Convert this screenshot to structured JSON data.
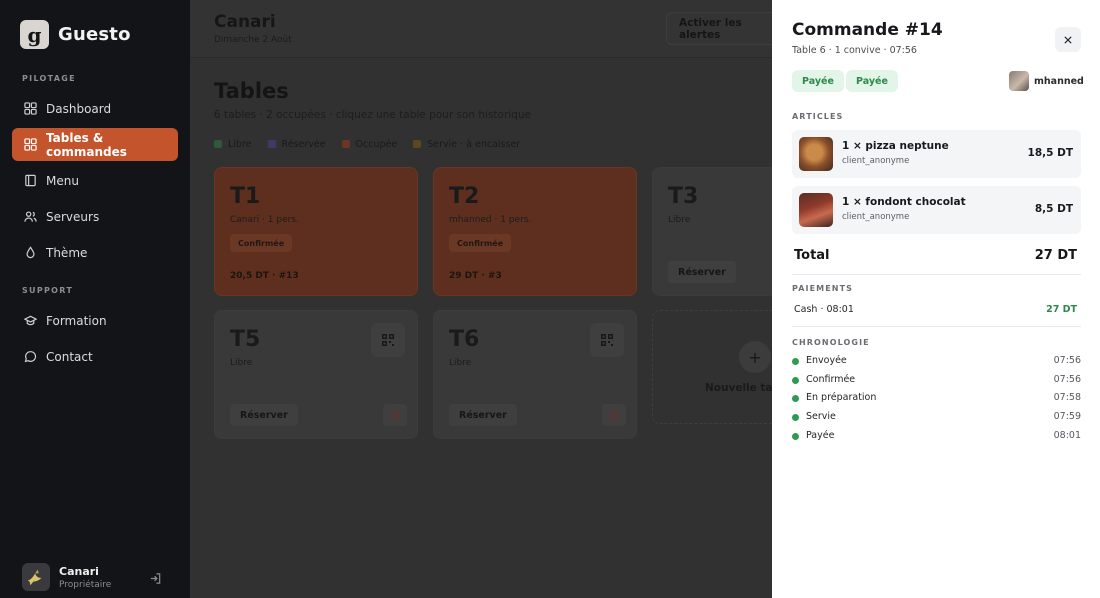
{
  "sidebar": {
    "brand": "Guesto",
    "brand_letter": "g",
    "sections": {
      "pilotage": "PILOTAGE",
      "support": "SUPPORT"
    },
    "items": [
      {
        "label": "Dashboard",
        "icon": "dashboard-icon"
      },
      {
        "label": "Tables & commandes",
        "icon": "tables-icon",
        "active": true
      },
      {
        "label": "Menu",
        "icon": "menu-book-icon"
      },
      {
        "label": "Serveurs",
        "icon": "users-icon"
      },
      {
        "label": "Thème",
        "icon": "droplet-icon"
      }
    ],
    "support_items": [
      {
        "label": "Formation",
        "icon": "graduation-cap-icon"
      },
      {
        "label": "Contact",
        "icon": "chat-bubble-icon"
      }
    ],
    "profile": {
      "name": "Canari",
      "role": "Propriétaire",
      "icon": "logout-icon"
    }
  },
  "header": {
    "venue": "Canari",
    "date": "Dimanche 2 Août",
    "alerts_button": "Activer les alertes"
  },
  "main": {
    "title": "Tables",
    "subtitle": "6 tables · 2 occupées · cliquez une table pour son historique",
    "legend": [
      {
        "label": "Libre",
        "color": "#2f7a45"
      },
      {
        "label": "Réservée",
        "color": "#4d4aa8"
      },
      {
        "label": "Occupée",
        "color": "#b04a25"
      },
      {
        "label": "Servie · à encaisser",
        "color": "#8a6a20"
      }
    ],
    "tables": [
      {
        "name": "T1",
        "sub": "Canari · 1 pers.",
        "badge": "Confirmée",
        "footer": "20,5 DT · #13"
      },
      {
        "name": "T2",
        "sub": "mhanned · 1 pers.",
        "badge": "Confirmée",
        "footer": "29 DT · #3"
      },
      {
        "name": "T3",
        "sub": "Libre",
        "action": "Réserver"
      },
      {
        "name": "T5",
        "sub": "Libre",
        "action": "Réserver"
      },
      {
        "name": "T6",
        "sub": "Libre",
        "action": "Réserver"
      }
    ],
    "new_table": "Nouvelle table"
  },
  "drawer": {
    "title": "Commande #14",
    "subtitle": "Table 6 · 1 convive · 07:56",
    "pills": [
      "Payée",
      "Payée"
    ],
    "user": "mhanned",
    "articles_label": "ARTICLES",
    "articles": [
      {
        "name": "1 × pizza neptune",
        "client": "client_anonyme",
        "price": "18,5 DT"
      },
      {
        "name": "1 × fondont chocolat",
        "client": "client_anonyme",
        "price": "8,5 DT"
      }
    ],
    "total_label": "Total",
    "total_value": "27 DT",
    "payments_label": "PAIEMENTS",
    "payment": {
      "method": "Cash · 08:01",
      "amount": "27 DT"
    },
    "timeline_label": "CHRONOLOGIE",
    "timeline": [
      {
        "label": "Envoyée",
        "time": "07:56"
      },
      {
        "label": "Confirmée",
        "time": "07:56"
      },
      {
        "label": "En préparation",
        "time": "07:58"
      },
      {
        "label": "Servie",
        "time": "07:59"
      },
      {
        "label": "Payée",
        "time": "08:01"
      }
    ]
  }
}
